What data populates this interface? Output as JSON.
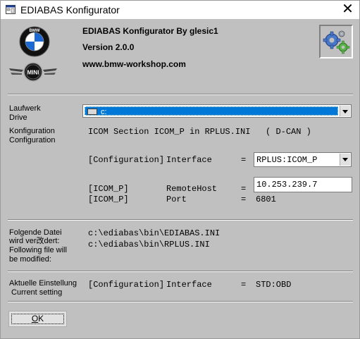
{
  "window": {
    "title": "EDIABAS Konfigurator",
    "close_symbol": "✕"
  },
  "header": {
    "app_name": "EDIABAS Konfigurator By glesic1",
    "version": "Version 2.0.0",
    "website": "www.bmw-workshop.com",
    "bmw_logo_text": "BMW",
    "mini_logo_text": "MINI",
    "settings_icon": "gears-icon"
  },
  "drive": {
    "label_de": "Laufwerk",
    "label_en": "Drive",
    "value": "c:"
  },
  "configuration": {
    "label_de": "Konfiguration",
    "label_en": "Configuration",
    "summary": "ICOM Section ICOM_P in RPLUS.INI   ( D-CAN )",
    "interface_row": {
      "section": "[Configuration]",
      "key": "Interface",
      "equals": "=",
      "value": "RPLUS:ICOM_P"
    },
    "remote_host_row": {
      "section": "[ICOM_P]",
      "key": "RemoteHost",
      "equals": "=",
      "value": "10.253.239.7"
    },
    "port_row": {
      "section": "[ICOM_P]",
      "key": "Port",
      "equals": "=",
      "value": "6801"
    }
  },
  "modified_files": {
    "label_line1": "Folgende Datei",
    "label_line2": "wird ver改dert:",
    "label_line3": "Following file will",
    "label_line4": "be modified:",
    "files": [
      "c:\\ediabas\\bin\\EDIABAS.INI",
      "c:\\ediabas\\bin\\RPLUS.INI"
    ]
  },
  "current_setting": {
    "label_de": "Aktuelle Einstellung",
    "label_en": " Current setting",
    "section": "[Configuration]",
    "key": "Interface",
    "equals": "=",
    "value": "STD:OBD"
  },
  "ok_button": {
    "label_underlined": "O",
    "label_rest": "K"
  }
}
